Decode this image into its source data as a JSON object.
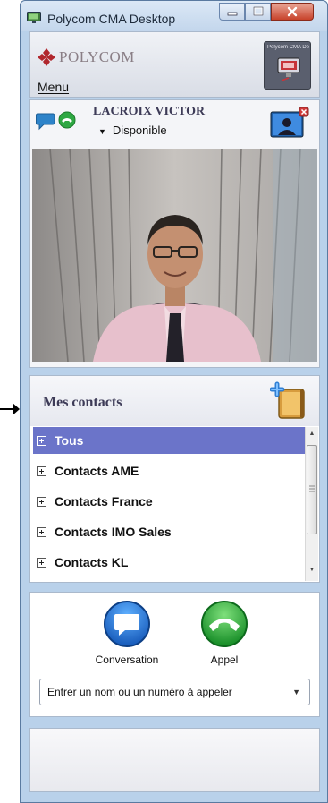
{
  "window": {
    "title": "Polycom CMA Desktop"
  },
  "header": {
    "logo_text": "POLYCOM",
    "menu_label": "Menu",
    "thumbnail_label": "Polycom CMA Desktop"
  },
  "user": {
    "name": "LACROIX VICTOR",
    "status": "Disponible"
  },
  "contacts": {
    "title": "Mes contacts",
    "items": [
      {
        "label": "Tous"
      },
      {
        "label": "Contacts AME"
      },
      {
        "label": "Contacts France"
      },
      {
        "label": "Contacts IMO Sales"
      },
      {
        "label": "Contacts KL"
      }
    ]
  },
  "call": {
    "conversation_label": "Conversation",
    "appel_label": "Appel",
    "dial_placeholder": "Entrer un nom ou un numéro à appeler"
  },
  "colors": {
    "selection": "#6b74c9",
    "title_text": "#3d3b57",
    "call_green": "#1c9a2e",
    "conversation_blue": "#1f6fd6"
  }
}
